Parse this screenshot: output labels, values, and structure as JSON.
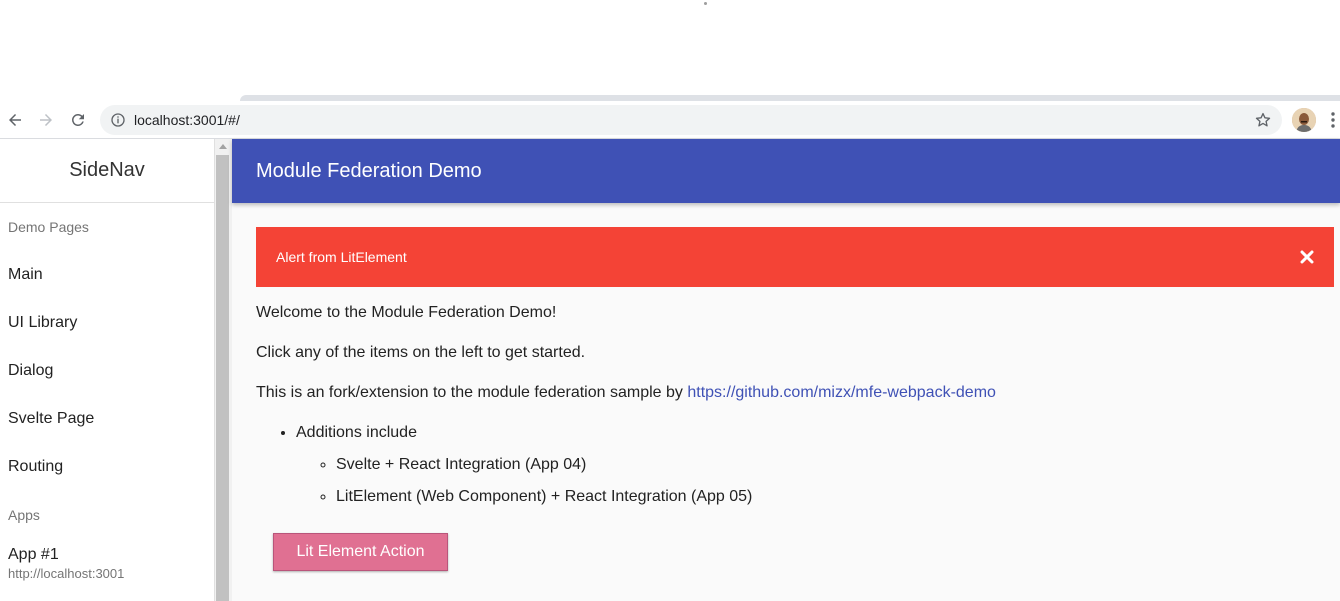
{
  "browser": {
    "url": "localhost:3001/#/",
    "icons": {
      "back": "arrow-left-icon",
      "forward": "arrow-right-icon",
      "reload": "reload-icon",
      "info": "info-icon",
      "bookmark": "star-icon",
      "menu": "more-vert-icon"
    }
  },
  "sidenav": {
    "title": "SideNav",
    "sections": [
      {
        "header": "Demo Pages",
        "items": [
          "Main",
          "UI Library",
          "Dialog",
          "Svelte Page",
          "Routing"
        ]
      },
      {
        "header": "Apps",
        "items": [
          {
            "label": "App #1",
            "secondary": "http://localhost:3001"
          }
        ]
      }
    ]
  },
  "header": {
    "title": "Module Federation Demo"
  },
  "alert": {
    "text": "Alert from LitElement",
    "color": "#f44336"
  },
  "content": {
    "welcome": "Welcome to the Module Federation Demo!",
    "instructions": "Click any of the items on the left to get started.",
    "fork_text": "This is an fork/extension to the module federation sample by",
    "fork_link": "https://github.com/mizx/mfe-webpack-demo",
    "additions": {
      "label": "Additions include",
      "items": [
        "Svelte + React Integration (App 04)",
        "LitElement (Web Component) + React Integration (App 05)"
      ]
    },
    "button_label": "Lit Element Action"
  },
  "colors": {
    "primary": "#3f51b5",
    "alert": "#f44336",
    "button": "#e07092"
  }
}
